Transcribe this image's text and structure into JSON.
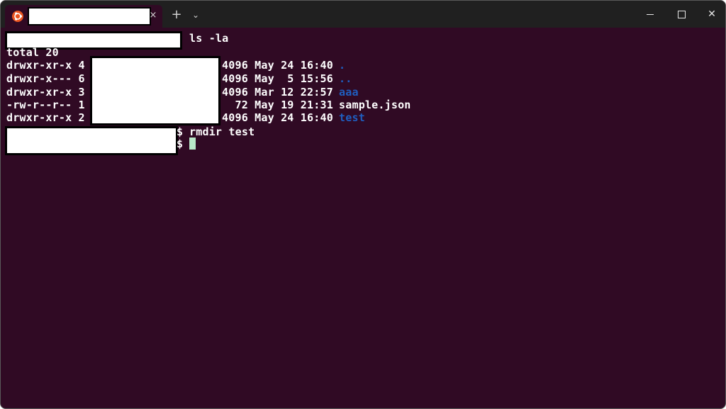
{
  "window": {
    "tab": {
      "icon": "ubuntu-icon",
      "close_glyph": "×"
    },
    "new_tab_glyph": "+",
    "dropdown_glyph": "⌄",
    "controls": {
      "minimize": "minimize-icon",
      "maximize": "maximize-icon",
      "close_glyph": "✕"
    }
  },
  "terminal": {
    "command1": "ls -la",
    "total": "total 20",
    "listing": [
      {
        "perms": "drwxr-xr-x 4",
        "size_date": "4096 May 24 16:40",
        "name": ".",
        "is_dir": true
      },
      {
        "perms": "drwxr-x--- 6",
        "size_date": "4096 May  5 15:56",
        "name": "..",
        "is_dir": true
      },
      {
        "perms": "drwxr-xr-x 3",
        "size_date": "4096 Mar 12 22:57",
        "name": "aaa",
        "is_dir": true
      },
      {
        "perms": "-rw-r--r-- 1",
        "size_date": "  72 May 19 21:31",
        "name": "sample.json",
        "is_dir": false
      },
      {
        "perms": "drwxr-xr-x 2",
        "size_date": "4096 May 24 16:40",
        "name": "test",
        "is_dir": true
      }
    ],
    "prompt_symbol": "$",
    "command2": "rmdir test"
  },
  "colors": {
    "terminal_bg": "#300a24",
    "dir_color": "#1f5ec0",
    "cursor": "#b8e8c8"
  }
}
